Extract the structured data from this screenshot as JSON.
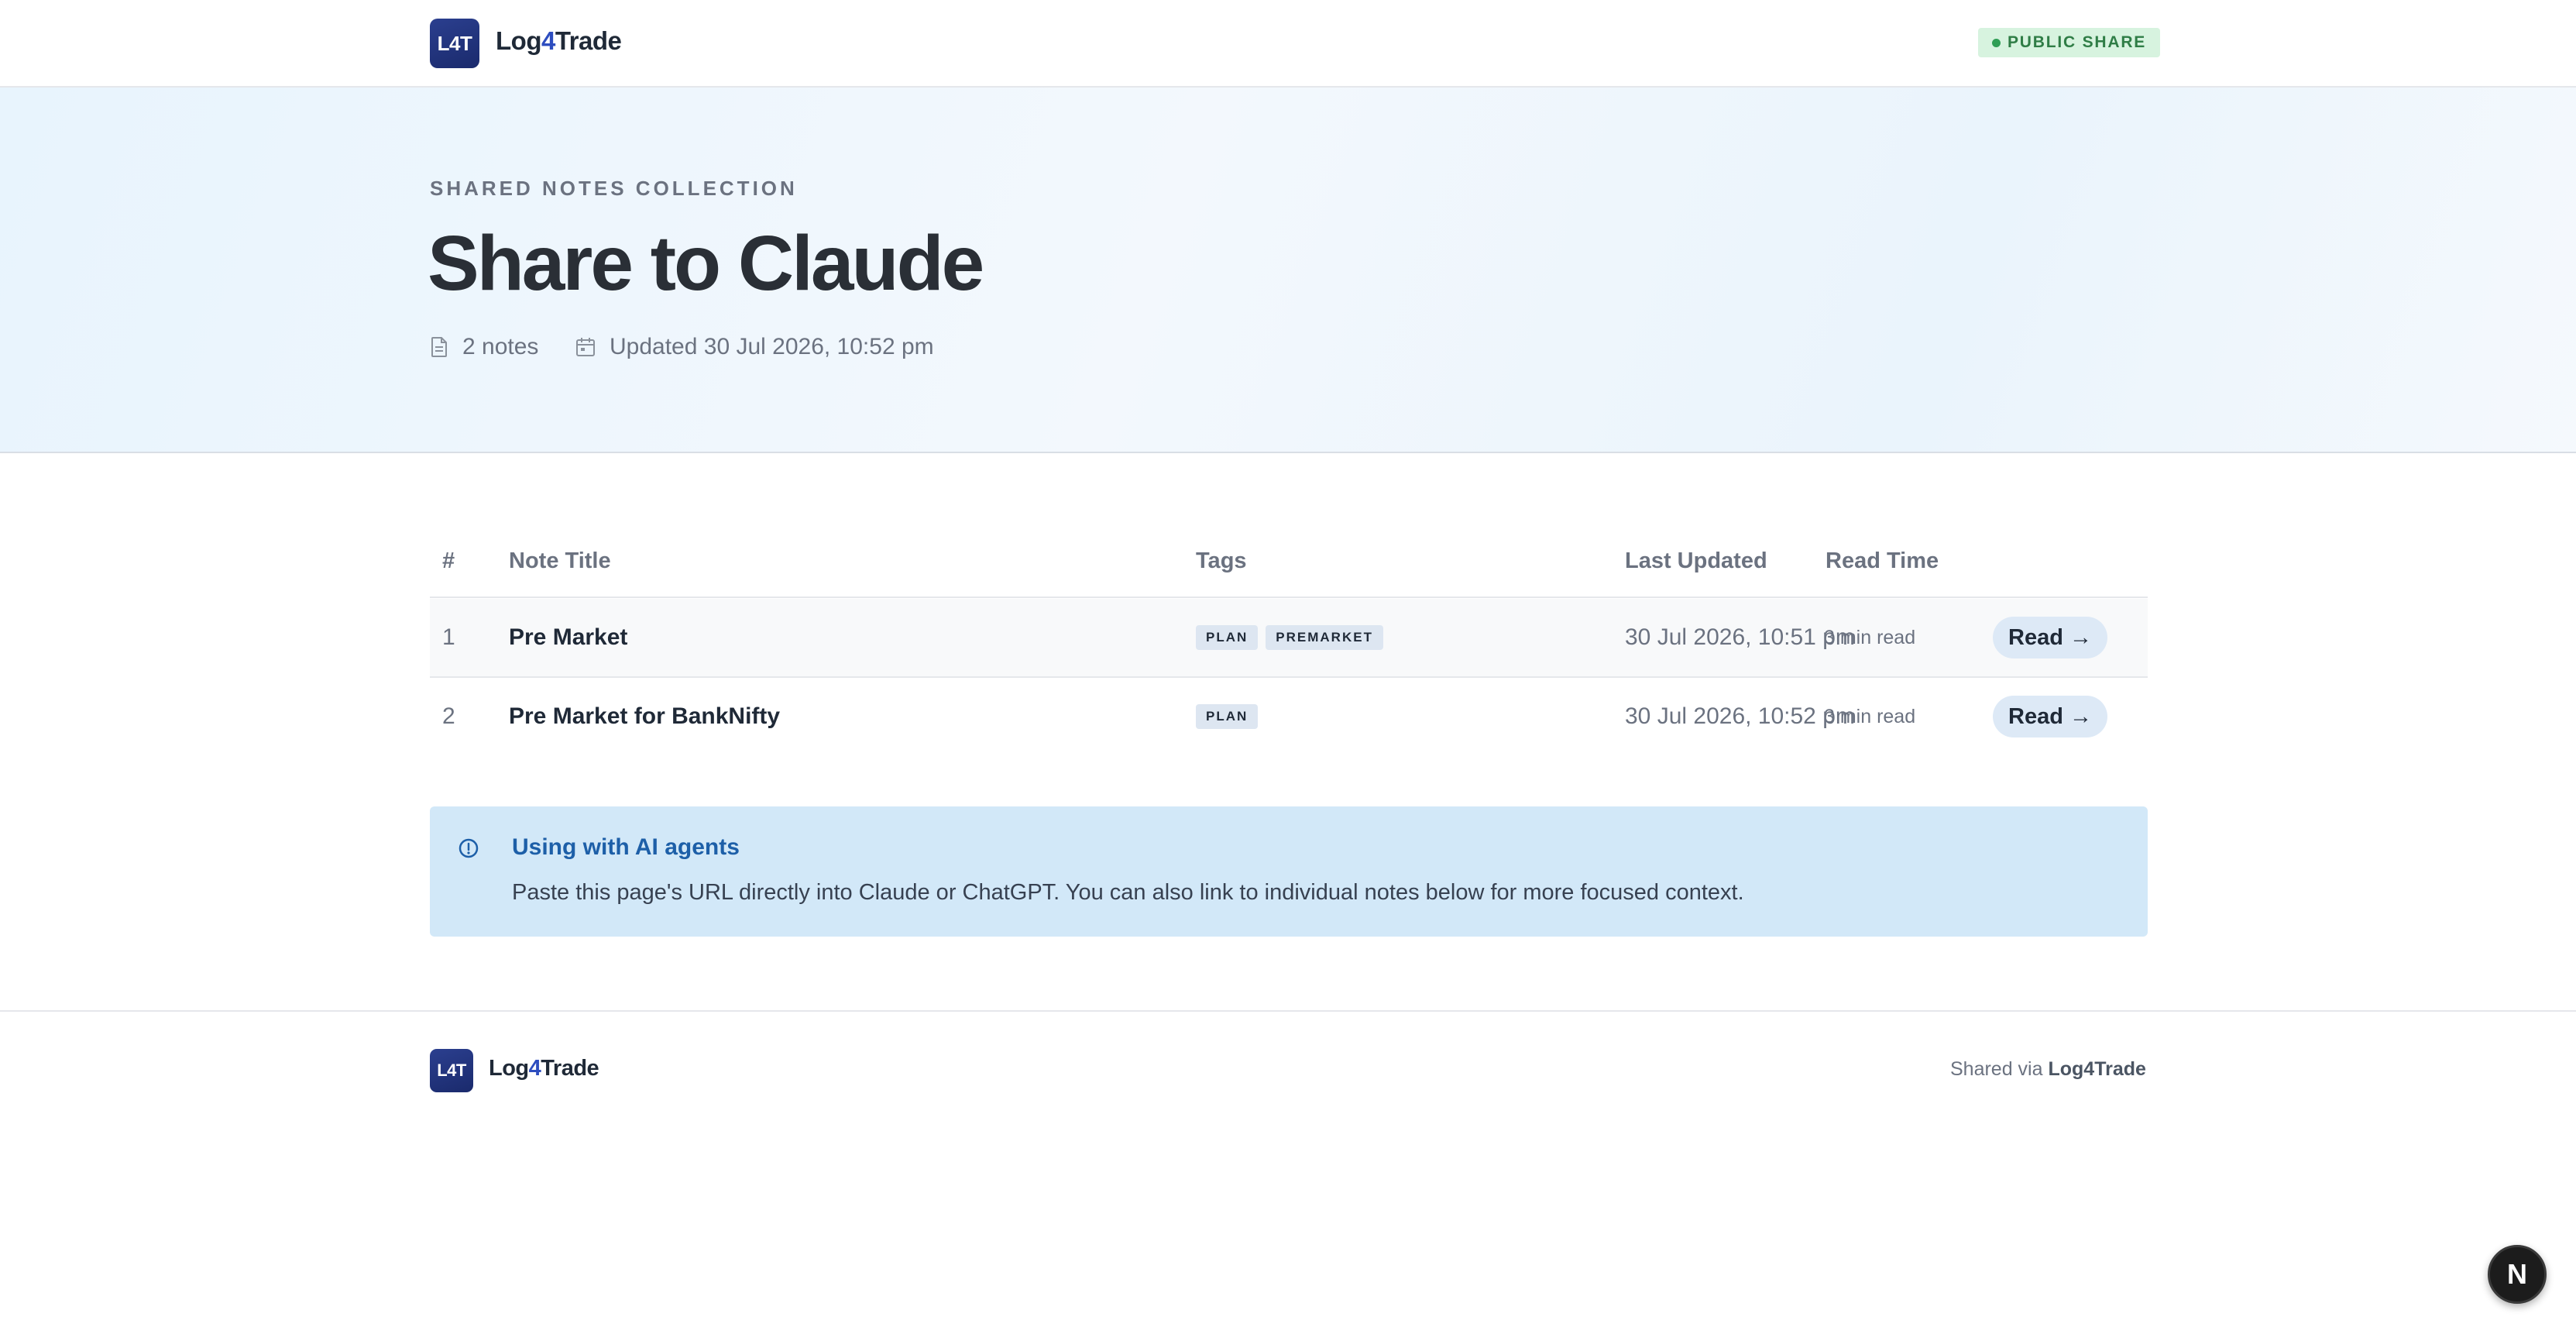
{
  "header": {
    "logo_text": "L4T",
    "brand_prefix": "Log",
    "brand_four": "4",
    "brand_suffix": "Trade",
    "badge": "PUBLIC SHARE"
  },
  "hero": {
    "eyebrow": "SHARED NOTES COLLECTION",
    "title": "Share to Claude",
    "notes_count": "2 notes",
    "updated": "Updated 30 Jul 2026, 10:52 pm"
  },
  "table": {
    "headers": {
      "num": "#",
      "title": "Note Title",
      "tags": "Tags",
      "updated": "Last Updated",
      "read_time": "Read Time"
    },
    "rows": [
      {
        "num": "1",
        "title": "Pre Market",
        "tags": [
          "PLAN",
          "PREMARKET"
        ],
        "updated": "30 Jul 2026, 10:51 pm",
        "read_time": "3 min read",
        "action": "Read →"
      },
      {
        "num": "2",
        "title": "Pre Market for BankNifty",
        "tags": [
          "PLAN"
        ],
        "updated": "30 Jul 2026, 10:52 pm",
        "read_time": "3 min read",
        "action": "Read →"
      }
    ]
  },
  "info": {
    "title": "Using with AI agents",
    "text": "Paste this page's URL directly into Claude or ChatGPT. You can also link to individual notes below for more focused context."
  },
  "footer": {
    "logo_text": "L4T",
    "brand_prefix": "Log",
    "brand_four": "4",
    "brand_suffix": "Trade",
    "shared_via": "Shared via",
    "shared_brand": "Log4Trade"
  },
  "floating": {
    "label": "N"
  },
  "colors": {
    "accent": "#2d4dbf",
    "badge_bg": "#d7f3df",
    "info_bg": "#d2e8f8",
    "info_title": "#1d5fa8"
  }
}
